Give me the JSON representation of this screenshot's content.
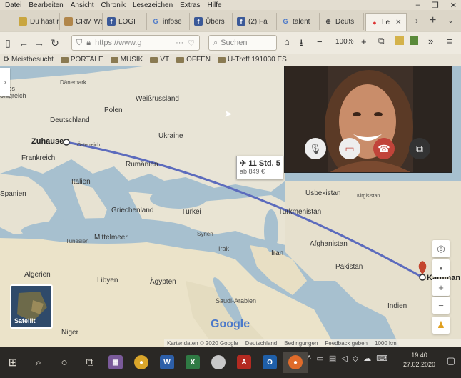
{
  "menu": [
    "Datei",
    "Bearbeiten",
    "Ansicht",
    "Chronik",
    "Lesezeichen",
    "Extras",
    "Hilfe"
  ],
  "tabs": [
    {
      "label": "Du hast n",
      "icon": "tab-icon"
    },
    {
      "label": "CRM Worl",
      "icon": "tab-icon"
    },
    {
      "label": "LOGI",
      "icon": "facebook-icon"
    },
    {
      "label": "infose",
      "icon": "google-icon"
    },
    {
      "label": "Übers",
      "icon": "facebook-icon"
    },
    {
      "label": "(2) Fa",
      "icon": "facebook-icon"
    },
    {
      "label": "talent",
      "icon": "google-icon"
    },
    {
      "label": "Deuts",
      "icon": "zoom-icon"
    },
    {
      "label": "Le",
      "icon": "map-pin-icon"
    }
  ],
  "nav": {
    "url": "https://www.g",
    "search_placeholder": "Suchen",
    "zoom": "100%"
  },
  "bookmarks": [
    {
      "label": "Meistbesucht",
      "icon": "gear-icon"
    },
    {
      "label": "PORTALE",
      "icon": "folder-icon"
    },
    {
      "label": "MUSIK",
      "icon": "folder-icon"
    },
    {
      "label": "VT",
      "icon": "folder-icon"
    },
    {
      "label": "OFFEN",
      "icon": "folder-icon"
    },
    {
      "label": "U-Treff 191030 ES",
      "icon": "folder-icon"
    }
  ],
  "map": {
    "labels": {
      "koenigreich1": "igtes",
      "koenigreich2": "önigreich",
      "daenemark": "Dänemark",
      "weissrussland": "Weißrussland",
      "polen": "Polen",
      "deutschland": "Deutschland",
      "ukraine": "Ukraine",
      "zuhause": "Zuhause",
      "oesterreich": "Österreich",
      "frankreich": "Frankreich",
      "rumaenien": "Rumänien",
      "italien": "Italien",
      "spanien": "Spanien",
      "griechenland": "Griechenland",
      "tuerkei": "Türkei",
      "usbekistan": "Usbekistan",
      "kirgisistan": "Kirgisistan",
      "turkmenistan": "Turkmenistan",
      "mittelmeer": "Mittelmeer",
      "syrien": "Syrien",
      "tunesien": "Tunesien",
      "irak": "Irak",
      "iran": "Iran",
      "afghanistan": "Afghanistan",
      "pakistan": "Pakistan",
      "algerien": "Algerien",
      "libyen": "Libyen",
      "aegypten": "Ägypten",
      "saudi": "Saudi-Arabien",
      "indien": "Indien",
      "niger": "Niger",
      "ktm": "Kathman"
    },
    "flight": {
      "duration": "11 Std. 5",
      "price": "ab 849 €"
    },
    "satellite_label": "Satellit",
    "google_logo": "Google",
    "footer": [
      "Kartendaten © 2020 Google",
      "Deutschland",
      "Bedingungen",
      "Feedback geben",
      "1000 km"
    ]
  },
  "video_call": {
    "buttons": [
      "microphone-icon",
      "camera-icon",
      "hang-up-icon",
      "switch-window-icon"
    ]
  },
  "taskbar": {
    "time": "19:40",
    "date": "27.02.2020"
  }
}
